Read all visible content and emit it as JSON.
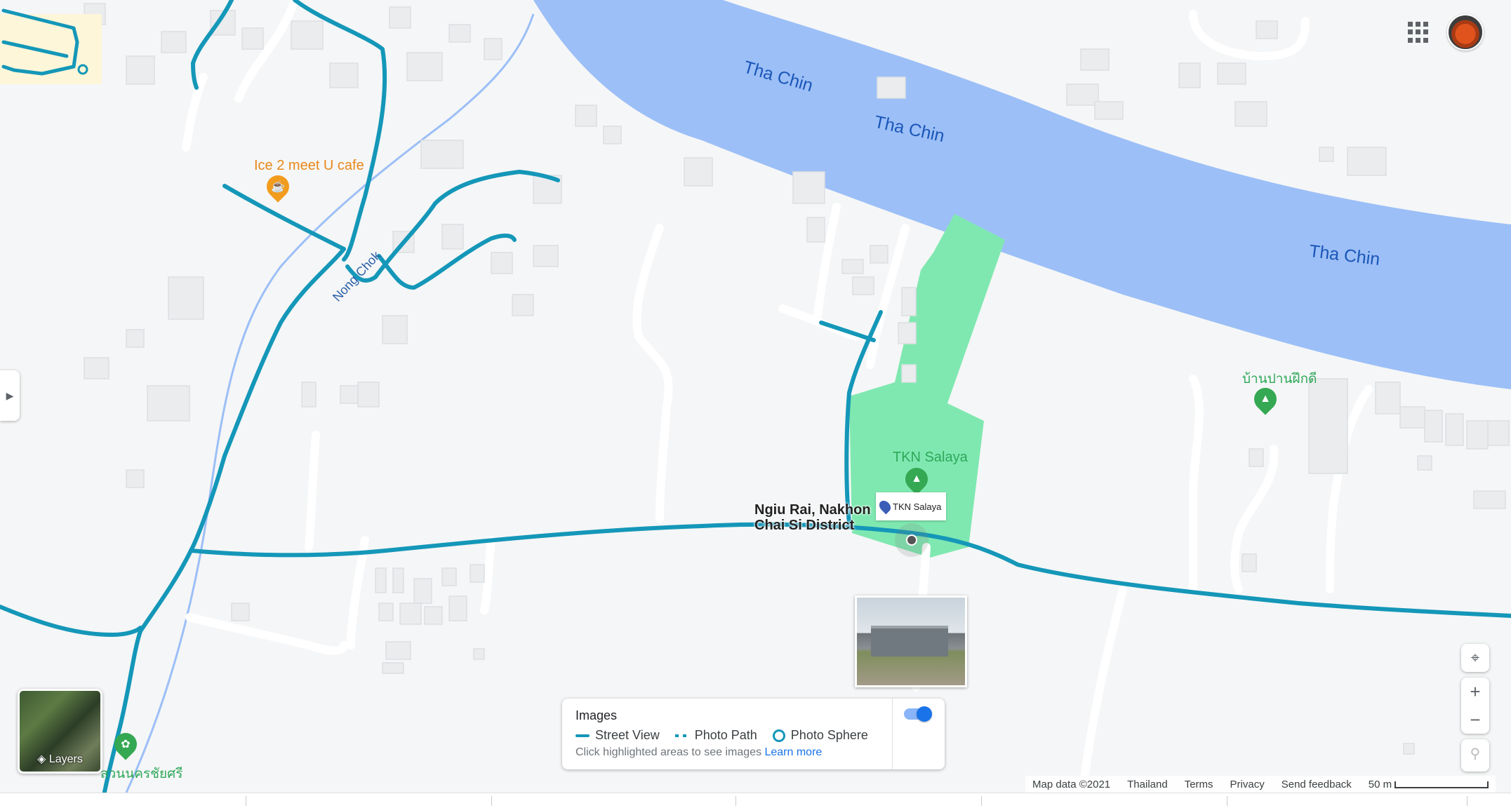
{
  "map": {
    "rivers": [
      "Tha Chin",
      "Tha Chin",
      "Tha Chin"
    ],
    "roads": [
      "Nong Chok"
    ],
    "places": {
      "cafe": "Ice 2 meet U cafe",
      "park": "TKN Salaya",
      "locality_line1": "Ngiu Rai, Nakhon",
      "locality_line2": "Chai Si District",
      "thai_place_1": "บ้านปานฝึกดี",
      "thai_place_2": "สวนนครชัยศรี"
    },
    "selected_pin_label": "TKN Salaya"
  },
  "layers": {
    "label": "Layers"
  },
  "images_panel": {
    "title": "Images",
    "legend": [
      "Street View",
      "Photo Path",
      "Photo Sphere"
    ],
    "hint": "Click highlighted areas to see images",
    "learn_more": "Learn more",
    "toggle_on": true
  },
  "controls": {
    "zoom_in": "+",
    "zoom_out": "−"
  },
  "footer": {
    "map_data": "Map data ©2021",
    "country": "Thailand",
    "terms": "Terms",
    "privacy": "Privacy",
    "feedback": "Send feedback",
    "scale": "50 m"
  },
  "colors": {
    "water": "#9cbff7",
    "park": "#7fe8b0",
    "street_view": "#1497b8",
    "road": "#ffffff",
    "building": "#eaecee"
  }
}
